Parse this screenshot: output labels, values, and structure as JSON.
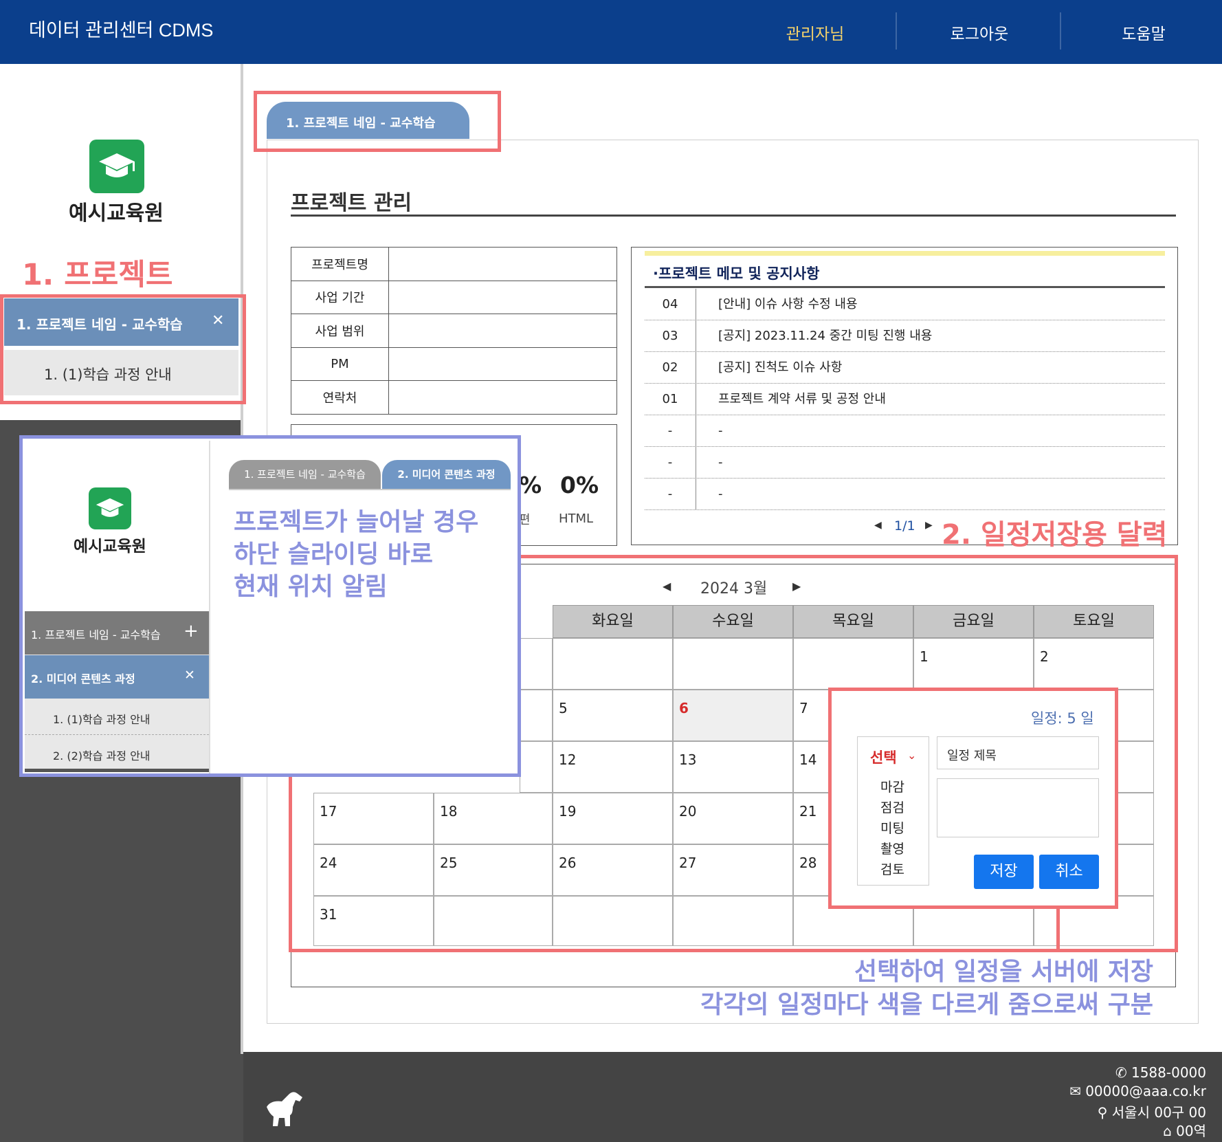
{
  "header": {
    "app_title": "데이터 관리센터 CDMS",
    "nav": [
      "관리자님",
      "로그아웃",
      "도움말"
    ]
  },
  "sidebar": {
    "org_name": "예시교육원",
    "section_label": "1. 프로젝트",
    "active_project": "1. 프로젝트 네임 - 교수학습",
    "active_project_close": "✕",
    "sub_item": "1. (1)학습 과정 안내"
  },
  "main": {
    "tab_label": "1. 프로젝트 네임 - 교수학습",
    "section_title": "프로젝트 관리",
    "info_rows": [
      "프로젝트명",
      "사업 기간",
      "사업 범위",
      "PM",
      "연락처"
    ],
    "stats": {
      "visible_pct": "%",
      "visible_sub": "편",
      "html_pct": "0%",
      "html_label": "HTML"
    },
    "notice": {
      "title": "·프로젝트 메모 및 공지사항",
      "rows": [
        {
          "no": "04",
          "title": "[안내] 이슈 사항 수정 내용"
        },
        {
          "no": "03",
          "title": "[공지] 2023.11.24 중간 미팅 진행 내용"
        },
        {
          "no": "02",
          "title": "[공지] 진척도 이슈 사항"
        },
        {
          "no": "01",
          "title": "프로젝트 계약 서류 및 공정 안내"
        },
        {
          "no": "-",
          "title": "-"
        },
        {
          "no": "-",
          "title": "-"
        },
        {
          "no": "-",
          "title": "-"
        }
      ],
      "pager": "1/1"
    },
    "calendar": {
      "month_label": "2024 3월",
      "day_headers": [
        "화요일",
        "수요일",
        "목요일",
        "금요일",
        "토요일"
      ],
      "highlight_day_color": "#d62b2b"
    }
  },
  "popup": {
    "duration": "일정: 5 일",
    "select_label": "선택",
    "options": [
      "마감",
      "점검",
      "미팅",
      "촬영",
      "검토"
    ],
    "title_placeholder": "일정 제목",
    "save": "저장",
    "cancel": "취소"
  },
  "overlay": {
    "org_name": "예시교육원",
    "tab1": "1. 프로젝트 네임 - 교수학습",
    "tab2": "2. 미디어 콘텐츠 과정",
    "menu_item1": "1. 프로젝트 네임 - 교수학습",
    "menu_item1_icon": "+",
    "menu_item2": "2. 미디어 콘텐츠 과정",
    "menu_item2_icon": "✕",
    "sub1": "1. (1)학습 과정 안내",
    "sub2": "2. (2)학습 과정 안내"
  },
  "annotations": {
    "slide_note": [
      "프로젝트가 늘어날 경우",
      "하단 슬라이딩 바로",
      "현재 위치 알림"
    ],
    "calendar_note": "2. 일정저장용 달력",
    "bottom_note": [
      "선택하여 일정을 서버에 저장",
      "각각의 일정마다 색을 다르게 줌으로써 구분"
    ]
  },
  "footer": {
    "phone": "1588-0000",
    "email": "00000@aaa.co.kr",
    "address": "서울시 00구 00",
    "station": "00역"
  },
  "colors": {
    "header_bg": "#0b3f8c",
    "accent_red": "#f07174",
    "accent_blue": "#8b92de",
    "tab_blue": "#7197c5",
    "button_blue": "#1476ee",
    "nav_active": "#f6d36a"
  }
}
